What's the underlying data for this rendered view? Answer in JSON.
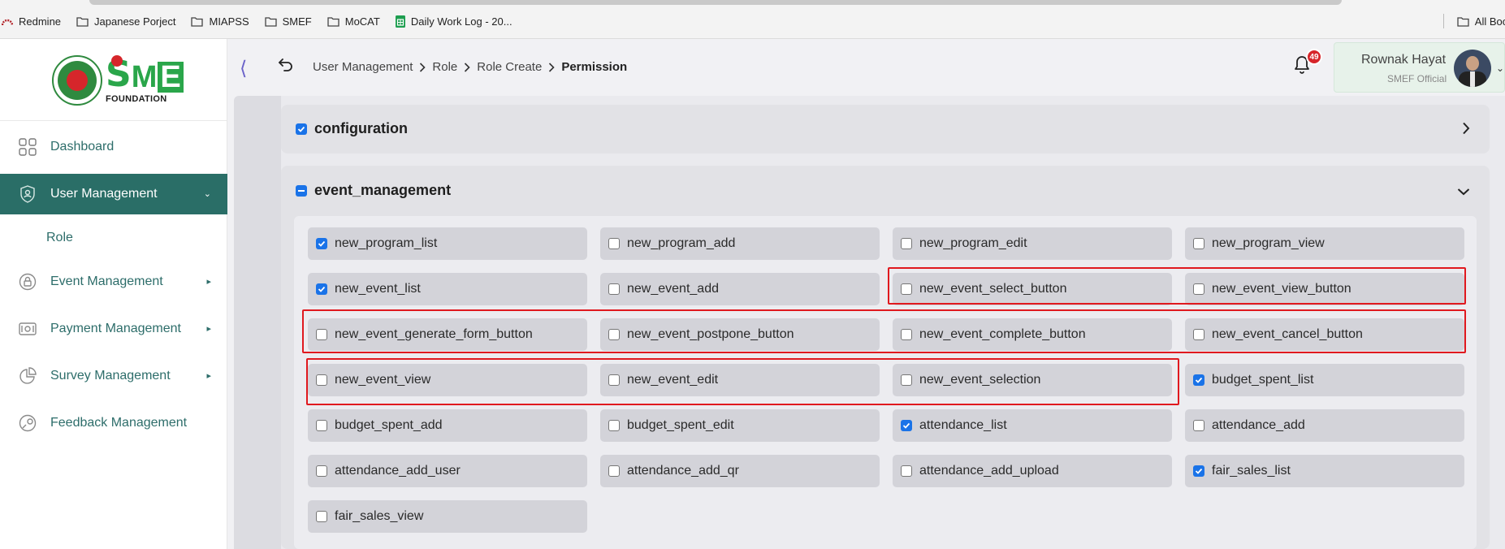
{
  "browser": {
    "bookmarks": [
      {
        "label": "Redmine",
        "icon": "redmine-icon"
      },
      {
        "label": "Japanese Porject",
        "icon": "folder-icon"
      },
      {
        "label": "MIAPSS",
        "icon": "folder-icon"
      },
      {
        "label": "SMEF",
        "icon": "folder-icon"
      },
      {
        "label": "MoCAT",
        "icon": "folder-icon"
      },
      {
        "label": "Daily Work Log - 20...",
        "icon": "sheets-icon"
      }
    ],
    "all_bookmarks": "All Boo"
  },
  "brand": {
    "logo_letters": [
      "S",
      "M",
      "E"
    ],
    "logo_subtitle": "FOUNDATION"
  },
  "sidebar": {
    "items": [
      {
        "label": "Dashboard",
        "icon": "dashboard-grid-icon",
        "active": false
      },
      {
        "label": "User Management",
        "icon": "user-shield-icon",
        "active": true
      },
      {
        "label": "Role",
        "sub": true
      },
      {
        "label": "Event Management",
        "icon": "lock-icon"
      },
      {
        "label": "Payment Management",
        "icon": "money-icon"
      },
      {
        "label": "Survey Management",
        "icon": "pie-chart-icon"
      },
      {
        "label": "Feedback Management",
        "icon": "feedback-icon"
      }
    ]
  },
  "header": {
    "breadcrumb": [
      "User Management",
      "Role",
      "Role Create",
      "Permission"
    ],
    "notifications": "49",
    "user_name": "Rownak Hayat",
    "user_role": "SMEF Official"
  },
  "groups": {
    "configuration": {
      "label": "configuration",
      "state": "checked",
      "expanded": false
    },
    "event_management": {
      "label": "event_management",
      "state": "mixed",
      "expanded": true
    }
  },
  "permissions": [
    {
      "label": "new_program_list",
      "checked": true
    },
    {
      "label": "new_program_add",
      "checked": false
    },
    {
      "label": "new_program_edit",
      "checked": false
    },
    {
      "label": "new_program_view",
      "checked": false
    },
    {
      "label": "new_event_list",
      "checked": true
    },
    {
      "label": "new_event_add",
      "checked": false
    },
    {
      "label": "new_event_select_button",
      "checked": false
    },
    {
      "label": "new_event_view_button",
      "checked": false
    },
    {
      "label": "new_event_generate_form_button",
      "checked": false
    },
    {
      "label": "new_event_postpone_button",
      "checked": false
    },
    {
      "label": "new_event_complete_button",
      "checked": false
    },
    {
      "label": "new_event_cancel_button",
      "checked": false
    },
    {
      "label": "new_event_view",
      "checked": false
    },
    {
      "label": "new_event_edit",
      "checked": false
    },
    {
      "label": "new_event_selection",
      "checked": false
    },
    {
      "label": "budget_spent_list",
      "checked": true
    },
    {
      "label": "budget_spent_add",
      "checked": false
    },
    {
      "label": "budget_spent_edit",
      "checked": false
    },
    {
      "label": "attendance_list",
      "checked": true
    },
    {
      "label": "attendance_add",
      "checked": false
    },
    {
      "label": "attendance_add_user",
      "checked": false
    },
    {
      "label": "attendance_add_qr",
      "checked": false
    },
    {
      "label": "attendance_add_upload",
      "checked": false
    },
    {
      "label": "fair_sales_list",
      "checked": true
    },
    {
      "label": "fair_sales_view",
      "checked": false
    }
  ],
  "colors": {
    "accent": "#2a6e67",
    "checkbox": "#1a73e8",
    "highlight": "#e0191f",
    "badge": "#d7252a"
  }
}
